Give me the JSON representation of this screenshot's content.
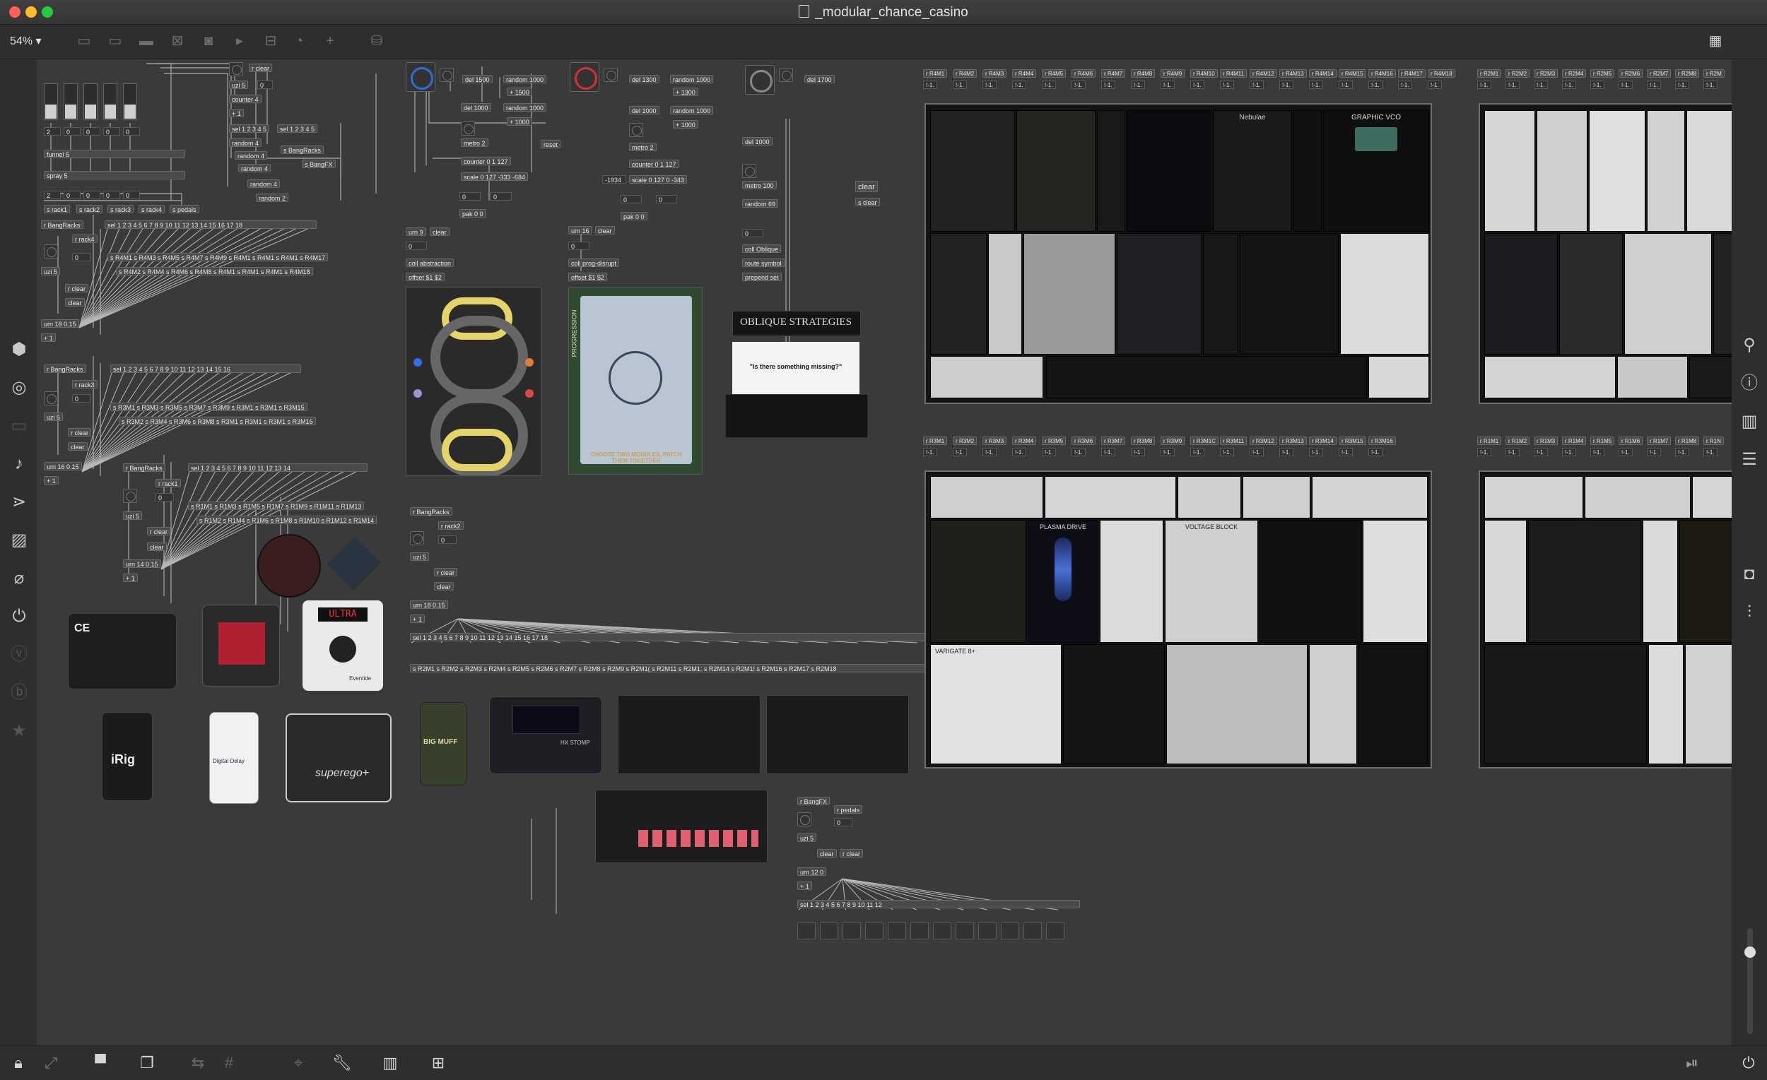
{
  "window": {
    "title": "_modular_chance_casino"
  },
  "toolbar": {
    "zoom": "54%"
  },
  "patch": {
    "block1": {
      "r_clear": "r clear",
      "uzi5": "uzi 5",
      "zero": "0",
      "counter4": "counter 4",
      "plus1": "+ 1",
      "sel12345": "sel 1 2 3 4 5",
      "sel12345b": "sel 1 2 3 4 5",
      "random4": "random 4",
      "s_BangRacks": "s BangRacks",
      "s_BangFX": "s BangFX",
      "random2": "random 2",
      "funnel5": "funnel 5",
      "spray5": "spray 5",
      "sends": [
        "s rack1",
        "s rack2",
        "s rack3",
        "s rack4",
        "s pedals"
      ],
      "nums": [
        "2",
        "0",
        "0",
        "0",
        "0"
      ]
    },
    "block2": {
      "del1500": "del 1500",
      "random1000": "random 1000",
      "plus1500": "+ 1500",
      "del1000": "del 1000",
      "plus1000": "+ 1000",
      "metro2": "metro 2",
      "counter": "counter 0 1 127",
      "scale": "scale 0 127 -333 -684",
      "reset": "reset",
      "pak": "pak 0 0",
      "urn9": "urn 9",
      "clear": "clear",
      "coll": "coll abstraction",
      "offset": "offset $1 $2"
    },
    "block3": {
      "del1300": "del 1300",
      "random1000": "random 1000",
      "plus1300": "+ 1300",
      "del1000": "del 1000",
      "plus1000": "+ 1000",
      "metro2": "metro 2",
      "counter": "counter 0 1 127",
      "scale": "scale 0 127 0 -343",
      "minus1934": "-1934",
      "pak": "pak 0 0",
      "urn16": "urn 16",
      "clear": "clear",
      "coll": "coll prog-disrupt",
      "offset": "offset $1 $2"
    },
    "block4": {
      "del1700": "del 1700",
      "del1000": "del 1000",
      "metro100": "metro 100",
      "random69": "random 69",
      "coll": "coll Oblique",
      "route": "route symbol",
      "prepend": "prepend set",
      "clear": "clear",
      "s_clear": "s clear"
    },
    "rack1_block": {
      "r_BangRacks": "r BangRacks",
      "r_rack4": "r rack4",
      "uzi5": "uzi 5",
      "r_clear": "r clear",
      "clear": "clear",
      "urn": "urn 18  0.15",
      "sel": "sel 1 2 3 4 5 6 7 8 9 10 11 12 13 14 15 16 17 18",
      "sends1": "s R4M1 s R4M3 s R4M5 s R4M7 s R4M9 s R4M1 s R4M1 s R4M1 s R4M17",
      "sends2": "s R4M2 s R4M4 s R4M6 s R4M8 s R4M1 s R4M1 s R4M1 s R4M18"
    },
    "rack3_block": {
      "r_BangRacks": "r BangRacks",
      "r_rack3": "r rack3",
      "uzi5": "uzi 5",
      "r_clear": "r clear",
      "clear": "clear",
      "urn": "urn 16  0.15",
      "sel": "sel 1 2 3 4 5 6 7 8 9 10 11 12 13 14 15 16",
      "sends1": "s R3M1 s R3M3 s R3M5 s R3M7 s R3M9 s R3M1 s R3M1 s R3M15",
      "sends2": "s R3M2 s R3M4 s R3M6 s R3M8 s R3M1 s R3M1 s R3M1 s R3M16"
    },
    "rack1b_block": {
      "r_BangRacks": "r BangRacks",
      "r_rack1": "r rack1",
      "uzi5": "uzi 5",
      "r_clear": "r clear",
      "clear": "clear",
      "urn": "urn 14  0.15",
      "sel": "sel 1 2 3 4 5 6 7 8 9 10 11 12 13 14",
      "sends1": "s R1M1 s R1M3 s R1M5 s R1M7 s R1M9 s R1M11 s R1M13",
      "sends2": "s R1M2 s R1M4 s R1M6 s R1M8 s R1M10 s R1M12 s R1M14"
    },
    "rack2_block": {
      "r_BangRacks": "r BangRacks",
      "r_rack2": "r rack2",
      "uzi5": "uzi 5",
      "r_clear": "r clear",
      "clear": "clear",
      "urn": "urn 18  0.15",
      "sel": "sel 1 2 3 4 5 6 7 8 9 10 11 12 13 14 15 16 17 18",
      "sends": "s R2M1 s R2M2 s R2M3 s R2M4 s R2M5 s R2M6 s R2M7 s R2M8 s R2M9 s R2M1( s R2M11 s R2M1: s R2M14 s R2M1! s R2M16 s R2M17 s R2M18"
    },
    "pedal_block": {
      "r_BangFX": "r BangFX",
      "r_pedals": "r pedals",
      "uzi5": "uzi 5",
      "clear": "clear",
      "r_clear": "r clear",
      "urn": "urn 12  0",
      "sel": "sel 1 2 3 4 5 6 7 8 9 10 11 12"
    },
    "receives": {
      "rack4": [
        "r R4M1",
        "r R4M2",
        "r R4M3",
        "r R4M4",
        "r R4M5",
        "r R4M6",
        "r R4M7",
        "r R4M8",
        "r R4M9",
        "r R4M10",
        "r R4M11",
        "r R4M12",
        "r R4M13",
        "r R4M14",
        "r R4M15",
        "r R4M16",
        "r R4M17",
        "r R4M18"
      ],
      "rack2": [
        "r R2M1",
        "r R2M2",
        "r R2M3",
        "r R2M4",
        "r R2M5",
        "r R2M6",
        "r R2M7",
        "r R2M8",
        "r R2M"
      ],
      "rack3": [
        "r R3M1",
        "r R3M2",
        "r R3M3",
        "r R3M4",
        "r R3M5",
        "r R3M6",
        "r R3M7",
        "r R3M8",
        "r R3M9",
        "r R3M1C",
        "r R3M11",
        "r R3M12",
        "r R3M13",
        "r R3M14",
        "r R3M15",
        "r R3M16"
      ],
      "rack1": [
        "r R1M1",
        "r R1M2",
        "r R1M3",
        "r R1M4",
        "r R1M5",
        "r R1M6",
        "r R1M7",
        "r R1M8",
        "r R1N"
      ],
      "hint": "!-1."
    },
    "media": {
      "oblique_title": "OBLIQUE STRATEGIES",
      "oblique_card": "\"Is there something missing?\"",
      "progression_side": "PROGRESSION",
      "progression_text": "CHOOSE TWO MODULES, PATCH THEM TOGETHER"
    },
    "modules": {
      "nebulae": "Nebulae",
      "graphic_vco": "GRAPHIC VCO",
      "plasma_drive": "PLASMA DRIVE",
      "voltage_block": "VOLTAGE BLOCK",
      "variga": "VARIGATE 8+",
      "ultra": "ULTRA",
      "eventide": "Eventide",
      "irig": "iRig",
      "superego": "superego+",
      "bigmuff": "BIG MUFF",
      "ce": "CE",
      "digital_delay": "Digital Delay",
      "hx": "HX STOMP"
    }
  },
  "colors": {
    "background": "#3a3a3a",
    "accent_blue": "#2e6fd6",
    "accent_red": "#d83030"
  }
}
